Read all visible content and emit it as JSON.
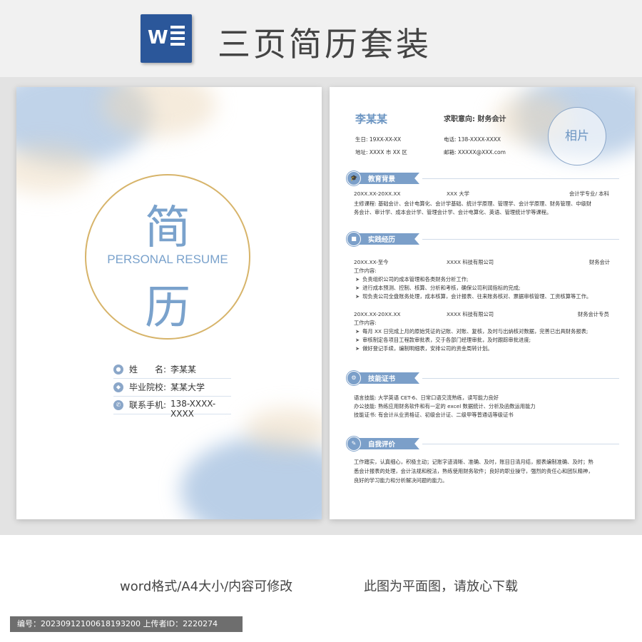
{
  "header": {
    "word_logo_letter": "W",
    "title": "三页简历套装"
  },
  "cover": {
    "char_top": "简",
    "subtitle": "PERSONAL RESUME",
    "char_bottom": "历",
    "info": [
      {
        "icon": "person-icon",
        "label": "姓　　名:",
        "value": "李某某"
      },
      {
        "icon": "location-icon",
        "label": "毕业院校:",
        "value": "某某大学"
      },
      {
        "icon": "phone-icon",
        "label": "联系手机:",
        "value": "138-XXXX-XXXX"
      }
    ]
  },
  "resume": {
    "name": "李某某",
    "intent": "求职意向: 财务会计",
    "birth": "生日: 19XX-XX-XX",
    "phone": "电话: 138-XXXX-XXXX",
    "address": "地址: XXXX 市 XX 区",
    "email": "邮箱: XXXXX@XXX.com",
    "photo_label": "相片",
    "sections": {
      "education": {
        "title": "教育背景",
        "period": "20XX.XX-20XX.XX",
        "school": "XXX 大学",
        "degree": "会计学专业/ 本科",
        "courses_1": "主修课程: 基础会计、会计电算化、会计学基础、统计学原理、管理学、会计学原理、财务管理、中级财",
        "courses_2": "务会计、审计学、成本会计学、管理会计学、会计电算化、英语、管理统计学等课程。"
      },
      "practice": {
        "title": "实践经历",
        "job1_period": "20XX.XX-至今",
        "job1_company": "XXXX 科技有限公司",
        "job1_role": "财务会计",
        "job1_content_label": "工作内容:",
        "job1_items": [
          "负责组织公司的成本管理和各类财务分析工作;",
          "进行成本预测、控制、核算、分析和考核，确保公司利润指标的完成;",
          "现负责公司全盘账务处理，成本核算，会计报表、往来账务核对、票据审核管理、工资核算等工作。"
        ],
        "job2_period": "20XX.XX-20XX.XX",
        "job2_company": "XXXX 科技有限公司",
        "job2_role": "财务会计专员",
        "job2_content_label": "工作内容:",
        "job2_items": [
          "每月 XX 日完成上月的原始凭证的记账、对账、复核，及时与出纳核对数据，完善已出具财务报表;",
          "审核制定各项目工程款审批表，交于各部门经理审批，及时跟踪审批进度;",
          "做好登记手续，编制明细表，安排公司的资金周转计划。"
        ]
      },
      "skills": {
        "title": "技能证书",
        "lang": "语言技能: 大学英语 CET-6、日常口语交流熟练，读写能力良好",
        "office": "办公技能: 熟练应用财务软件和有一定的 excel 数据统计、分析及函数运用能力",
        "cert": "技能证书: 有会计从业资格证、初级会计证、二级甲等普通话等级证书"
      },
      "self": {
        "title": "自我评价",
        "line1": "工作踏实，认真细心，积极主动；记账字迹清晰、准确、及时，账目日清月结，报表编制准确、及时；熟",
        "line2": "悉会计报表的处理，会计法规和税法，熟练使用财务软件；良好的职业操守，强烈的责任心和团队精神，",
        "line3": "良好的学习能力和分析解决问题的能力。"
      }
    }
  },
  "footer": {
    "left": "word格式/A4大小/内容可修改",
    "right": "此图为平面图，请放心下载",
    "id_bar": "编号：20230912100618193200  上传者ID：2220274"
  },
  "colors": {
    "accent_blue": "#7b9fc9",
    "gold": "#d7b46a",
    "word_blue": "#2b579a"
  }
}
